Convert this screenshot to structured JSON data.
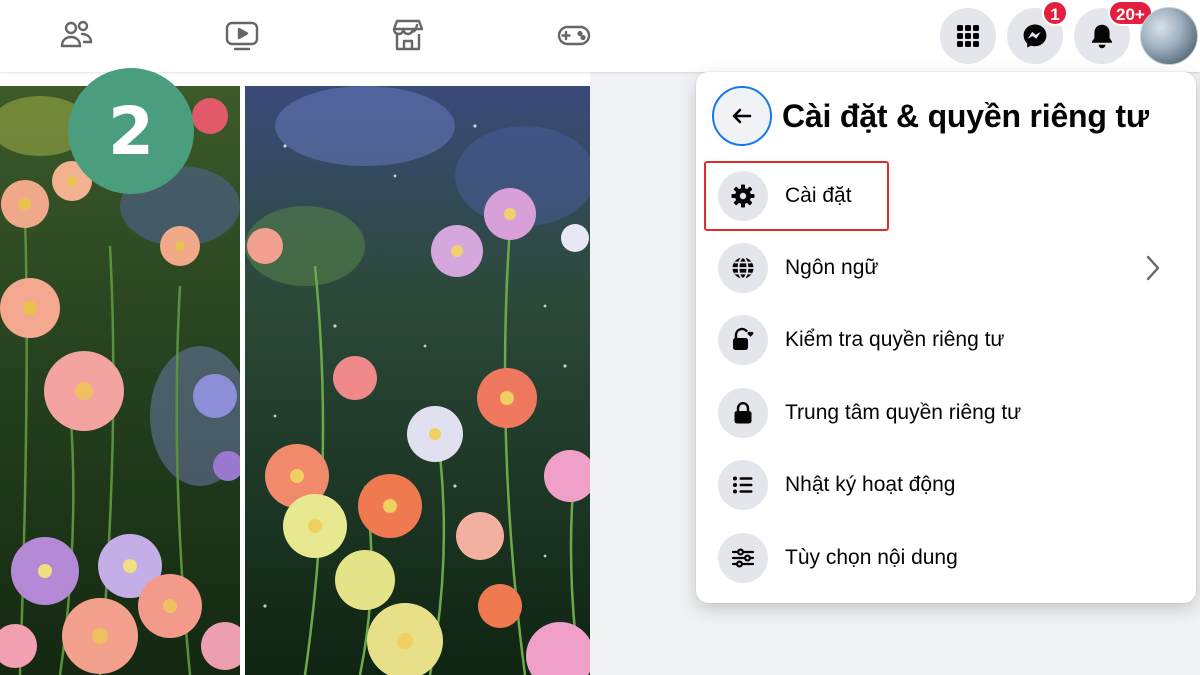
{
  "top_nav": {
    "tabs": [
      {
        "icon": "friends-icon"
      },
      {
        "icon": "video-icon"
      },
      {
        "icon": "marketplace-icon"
      },
      {
        "icon": "gaming-icon"
      }
    ],
    "actions": {
      "menu": {
        "icon": "grid-menu-icon"
      },
      "messenger": {
        "icon": "messenger-icon",
        "badge": "1"
      },
      "notifications": {
        "icon": "bell-icon",
        "badge": "20+"
      },
      "profile": {
        "icon": "avatar"
      }
    }
  },
  "step_badge": "2",
  "settings_menu": {
    "title": "Cài đặt & quyền riêng tư",
    "items": [
      {
        "label": "Cài đặt",
        "icon": "gear-icon",
        "highlighted": true
      },
      {
        "label": "Ngôn ngữ",
        "icon": "globe-icon",
        "has_submenu": true
      },
      {
        "label": "Kiểm tra quyền riêng tư",
        "icon": "lock-heart-icon"
      },
      {
        "label": "Trung tâm quyền riêng tư",
        "icon": "lock-icon"
      },
      {
        "label": "Nhật ký hoạt động",
        "icon": "list-icon"
      },
      {
        "label": "Tùy chọn nội dung",
        "icon": "sliders-icon"
      }
    ]
  },
  "colors": {
    "brand_blue": "#1877f2",
    "badge_red": "#e41e3f",
    "highlight_red": "#e02b2b",
    "step_badge_green": "#4a9e7e",
    "icon_grey": "#65676b"
  }
}
